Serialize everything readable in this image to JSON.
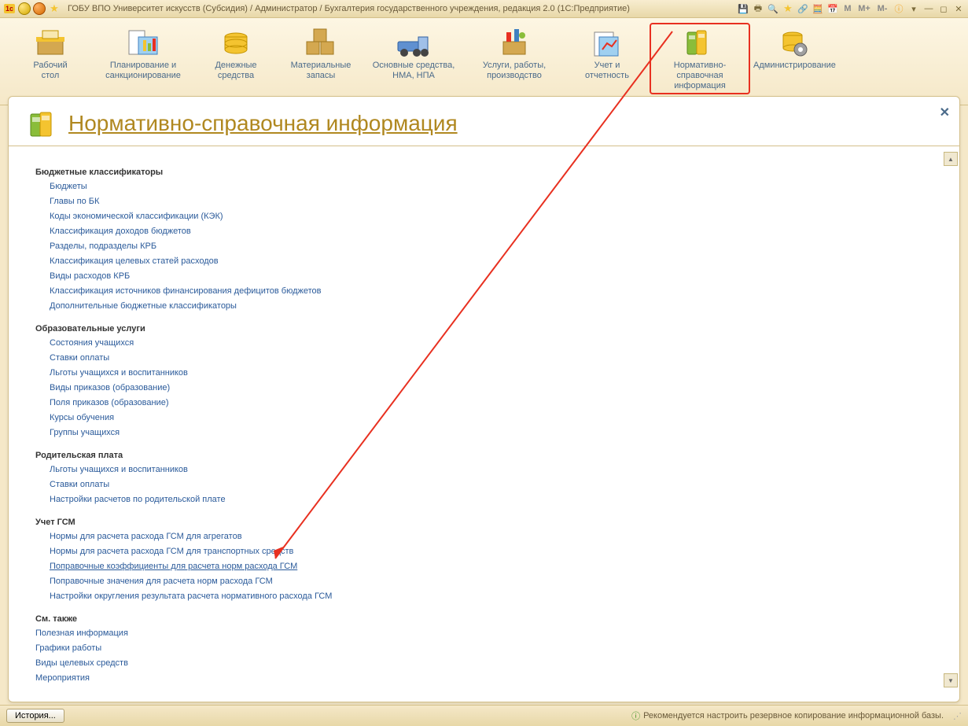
{
  "titlebar": {
    "title": "ГОБУ ВПО Университет искусств (Субсидия) / Администратор / Бухгалтерия государственного учреждения, редакция 2.0  (1С:Предприятие)",
    "m": "M",
    "mplus": "M+",
    "mminus": "M-"
  },
  "toolbar": [
    {
      "id": "desktop",
      "label": "Рабочий\nстол"
    },
    {
      "id": "planning",
      "label": "Планирование и\nсанкционирование"
    },
    {
      "id": "money",
      "label": "Денежные\nсредства"
    },
    {
      "id": "materials",
      "label": "Материальные\nзапасы"
    },
    {
      "id": "assets",
      "label": "Основные средства,\nНМА, НПА"
    },
    {
      "id": "services",
      "label": "Услуги, работы,\nпроизводство"
    },
    {
      "id": "reports",
      "label": "Учет и\nотчетность"
    },
    {
      "id": "reference",
      "label": "Нормативно-справочная\nинформация",
      "active": true
    },
    {
      "id": "admin",
      "label": "Администрирование"
    }
  ],
  "page": {
    "title": "Нормативно-справочная информация",
    "sections": [
      {
        "title": "Бюджетные классификаторы",
        "items": [
          "Бюджеты",
          "Главы по БК",
          "Коды экономической классификации (КЭК)",
          "Классификация доходов бюджетов",
          "Разделы, подразделы КРБ",
          "Классификация целевых статей расходов",
          "Виды расходов КРБ",
          "Классификация источников финансирования дефицитов бюджетов",
          "Дополнительные бюджетные классификаторы"
        ]
      },
      {
        "title": "Образовательные услуги",
        "items": [
          "Состояния учащихся",
          "Ставки оплаты",
          "Льготы учащихся и воспитанников",
          "Виды приказов (образование)",
          "Поля приказов (образование)",
          "Курсы обучения",
          "Группы учащихся"
        ]
      },
      {
        "title": "Родительская плата",
        "items": [
          "Льготы учащихся и воспитанников",
          "Ставки оплаты",
          "Настройки расчетов по родительской плате"
        ]
      },
      {
        "title": "Учет ГСМ",
        "items": [
          "Нормы для расчета расхода ГСМ для агрегатов",
          "Нормы для расчета расхода ГСМ для транспортных средств",
          "Поправочные коэффициенты для расчета норм расхода ГСМ",
          "Поправочные значения для расчета норм расхода ГСМ",
          "Настройки округления результата расчета нормативного расхода ГСМ"
        ],
        "underlined": 2
      },
      {
        "title": "См. также",
        "indent": false,
        "items": [
          "Полезная информация",
          "Графики работы",
          "Виды целевых средств",
          "Мероприятия"
        ]
      }
    ]
  },
  "status": {
    "history": "История...",
    "msg": "Рекомендуется настроить резервное копирование информационной базы."
  }
}
